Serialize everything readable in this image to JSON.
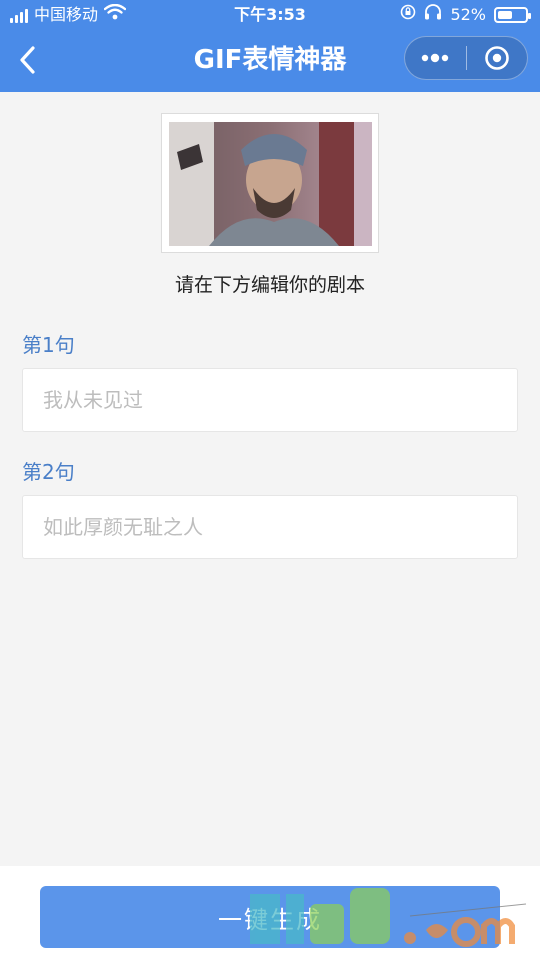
{
  "status_bar": {
    "carrier": "中国移动",
    "time": "下午3:53",
    "battery": "52%",
    "battery_level": 0.52,
    "icons": [
      "signal-icon",
      "wifi-icon",
      "rotation-lock-icon",
      "headphones-icon",
      "battery-icon"
    ]
  },
  "nav": {
    "title": "GIF表情神器",
    "back_icon": "chevron-left-icon",
    "more_icon": "more-dots-icon",
    "close_icon": "target-close-icon"
  },
  "content": {
    "hint": "请在下方编辑你的剧本",
    "lines": [
      {
        "label": "第1句",
        "placeholder": "我从未见过",
        "value": ""
      },
      {
        "label": "第2句",
        "placeholder": "如此厚颜无耻之人",
        "value": ""
      }
    ]
  },
  "actions": {
    "generate_label": "一键生成"
  },
  "colors": {
    "header": "#4a8be8",
    "label": "#4a7fc8",
    "button": "#5b95ea",
    "background": "#f4f4f4"
  }
}
